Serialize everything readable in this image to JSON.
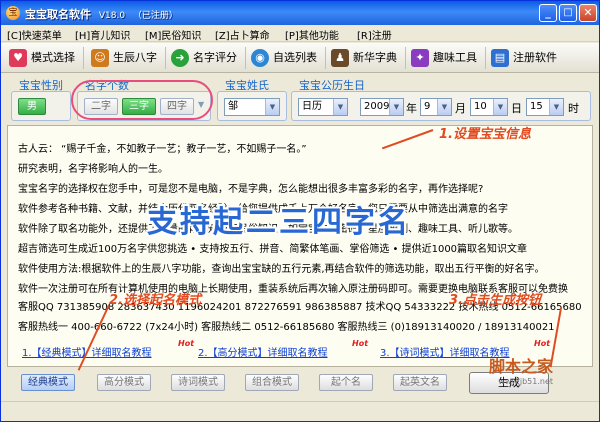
{
  "window": {
    "title": "宝宝取名软件",
    "version": "V18.0",
    "reg_status": "（已注册）",
    "min": "_",
    "max": "□",
    "close": "✕"
  },
  "menu": [
    "[C]快速菜单",
    "[H]育儿知识",
    "[M]民俗知识",
    "[Z]占卜算命",
    "[P]其他功能",
    "[R]注册"
  ],
  "toolbar": [
    {
      "label": "模式选择",
      "icon": "heart-icon",
      "color": "#e03a5b"
    },
    {
      "label": "生辰八字",
      "icon": "person-icon",
      "color": "#d07a1e"
    },
    {
      "label": "名字评分",
      "icon": "arrow-right-icon",
      "color": "#2aa23a"
    },
    {
      "label": "自选列表",
      "icon": "earth-icon",
      "color": "#2c86d4"
    },
    {
      "label": "新华字典",
      "icon": "scholar-icon",
      "color": "#6b4a2a"
    },
    {
      "label": "趣味工具",
      "icon": "puzzle-icon",
      "color": "#8a3cc0"
    },
    {
      "label": "注册软件",
      "icon": "register-icon",
      "color": "#2f6fd0"
    }
  ],
  "gender": {
    "label": "宝宝性别",
    "value": "男"
  },
  "name_count": {
    "label": "名字个数",
    "options": [
      "二字",
      "三字",
      "四字"
    ],
    "selected": "三字"
  },
  "surname": {
    "label": "宝宝姓氏",
    "value": "邹"
  },
  "birth": {
    "label": "宝宝公历生日",
    "calendar": "日历",
    "year": "2009",
    "year_unit": "年",
    "month": "9",
    "month_unit": "月",
    "day": "10",
    "day_unit": "日",
    "hour": "15",
    "hour_unit": "时"
  },
  "content_lines": [
    "古人云：  “赐子千金，不如教子一艺；教子一艺，不如赐子一名。”",
    "研究表明，名字将影响人的一生。",
    "宝宝名字的选择权在您手中，可是您不是电脑，不是字典，怎么能想出很多丰富多彩的名字，再作选择呢?",
    "软件参考各种书籍、文献，并结合历代取名经验，给您提供成千上万个好名字，您只需要从中筛选出满意的名字",
    "软件除了取名功能外，还提供了大量的育儿知识和民俗知识，如宝宝生日密码、星座预测、趣味工具、听儿歌等。",
    "超吉筛选可生成近100万名字供您挑选  •  支持按五行、拼音、简繁体笔画、掌俗筛选  •  提供近1000篇取名知识文章",
    "软件使用方法:根据软件上的生辰八字功能，查询出宝宝缺的五行元素,再结合软件的筛选功能，取出五行平衡的好名字。",
    "软件一次注册可在所有计算机使用的电脑上长期使用，重装系统后再次输入原注册码即可。需要更换电脑联系客服可以免费换",
    "客服QQ 731385908  283637430  1196024201  872276591  986385887   技术QQ 54333222   技术热线 0512-66165680",
    "客服热线一 400-660-6722 (7x24小时)   客服热线二 0512-66185680   客服热线三 (0)18913140020 / 18913140021"
  ],
  "annotations": {
    "step1": "1.设置宝宝信息",
    "step2": "2.选择起名模式",
    "step3": "3.点击生成按钮",
    "headline": "支持起二三四字名"
  },
  "links": [
    {
      "text": "1.【经典模式】详细取名教程",
      "hot": "Hot"
    },
    {
      "text": "2.【高分模式】详细取名教程",
      "hot": "Hot"
    },
    {
      "text": "3.【诗词模式】详细取名教程",
      "hot": "Hot"
    }
  ],
  "mode_tabs": [
    "经典模式",
    "高分模式",
    "诗词模式",
    "组合模式",
    "起个名",
    "起英文名"
  ],
  "mode_selected": "经典模式",
  "generate_button": "生成",
  "watermark": {
    "text": "脚本之家",
    "url": "www.jb51.net"
  }
}
